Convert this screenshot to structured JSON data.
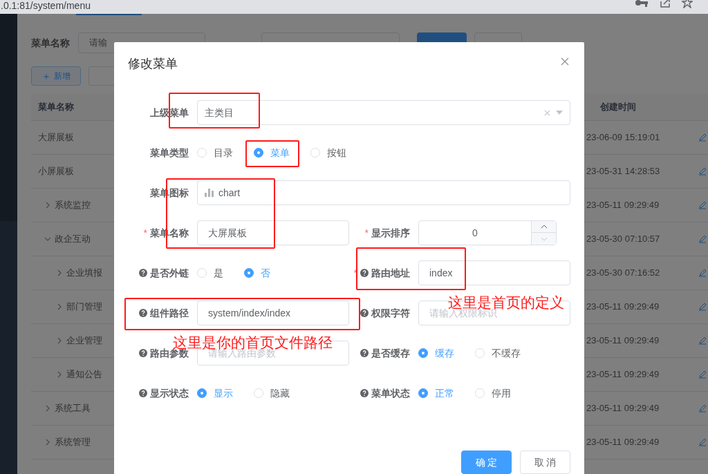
{
  "browser": {
    "url": ".0.1:81/system/menu"
  },
  "background": {
    "search": {
      "label": "菜单名称",
      "placeholder": "请输"
    },
    "add_button": {
      "icon": "＋",
      "label": "新增"
    },
    "table": {
      "columns": [
        "菜单名称",
        "创建时间"
      ],
      "rows": [
        {
          "name": "大屏展板",
          "created": "23-06-09 15:19:01"
        },
        {
          "name": "小屏展板",
          "created": "23-05-31 14:28:53"
        },
        {
          "name": "系统监控",
          "created": "23-05-11 09:29:49",
          "expanded": false
        },
        {
          "name": "政企互动",
          "created": "23-05-30 07:10:57",
          "expanded": true,
          "children": [
            {
              "name": "企业填报",
              "created": "23-05-30 07:16:52",
              "expanded": false
            },
            {
              "name": "部门管理",
              "created": "23-05-11 09:29:49",
              "expanded": false
            },
            {
              "name": "企业管理",
              "created": "23-05-11 09:29:49",
              "expanded": false
            },
            {
              "name": "通知公告",
              "created": "23-05-11 09:29:49",
              "expanded": false
            }
          ]
        },
        {
          "name": "系统工具",
          "created": "23-05-11 09:29:49",
          "expanded": false
        },
        {
          "name": "系统管理",
          "created": "23-05-11 09:29:49",
          "expanded": false
        }
      ]
    }
  },
  "dialog": {
    "title": "修改菜单",
    "rows": [
      [
        {
          "kind": "select",
          "label": "上级菜单",
          "value": "主类目"
        }
      ],
      [
        {
          "kind": "radio",
          "label": "菜单类型",
          "options": [
            {
              "label": "目录",
              "selected": false
            },
            {
              "label": "菜单",
              "selected": true
            },
            {
              "label": "按钮",
              "selected": false
            }
          ]
        }
      ],
      [
        {
          "kind": "icon-input",
          "label": "菜单图标",
          "value": "chart"
        }
      ],
      [
        {
          "kind": "input",
          "label": "菜单名称",
          "required_mark": "*",
          "value": "大屏展板"
        },
        {
          "kind": "number",
          "label": "显示排序",
          "required_mark": "*",
          "value": "0"
        }
      ],
      [
        {
          "kind": "radio",
          "label": "是否外链",
          "help": true,
          "options": [
            {
              "label": "是",
              "selected": false
            },
            {
              "label": "否",
              "selected": true
            }
          ]
        },
        {
          "kind": "input",
          "label": "路由地址",
          "required_mark": "*",
          "help": true,
          "value": "index"
        }
      ],
      [
        {
          "kind": "input",
          "label": "组件路径",
          "help": true,
          "value": "system/index/index"
        },
        {
          "kind": "input",
          "label": "权限字符",
          "help": true,
          "placeholder": "请输入权限标识"
        }
      ],
      [
        {
          "kind": "input",
          "label": "路由参数",
          "help": true,
          "placeholder": "请输入路由参数"
        },
        {
          "kind": "radio",
          "label": "是否缓存",
          "help": true,
          "options": [
            {
              "label": "缓存",
              "selected": true
            },
            {
              "label": "不缓存",
              "selected": false
            }
          ]
        }
      ],
      [
        {
          "kind": "radio",
          "label": "显示状态",
          "help": true,
          "options": [
            {
              "label": "显示",
              "selected": true
            },
            {
              "label": "隐藏",
              "selected": false
            }
          ]
        },
        {
          "kind": "radio",
          "label": "菜单状态",
          "help": true,
          "options": [
            {
              "label": "正常",
              "selected": true
            },
            {
              "label": "停用",
              "selected": false
            }
          ]
        }
      ]
    ],
    "buttons": [
      {
        "label": "确 定",
        "kind": "primary"
      },
      {
        "label": "取 消",
        "kind": "default"
      }
    ]
  },
  "annotations": [
    {
      "text": "这里是首页的定义"
    },
    {
      "text": "这里是你的首页文件路径"
    }
  ]
}
